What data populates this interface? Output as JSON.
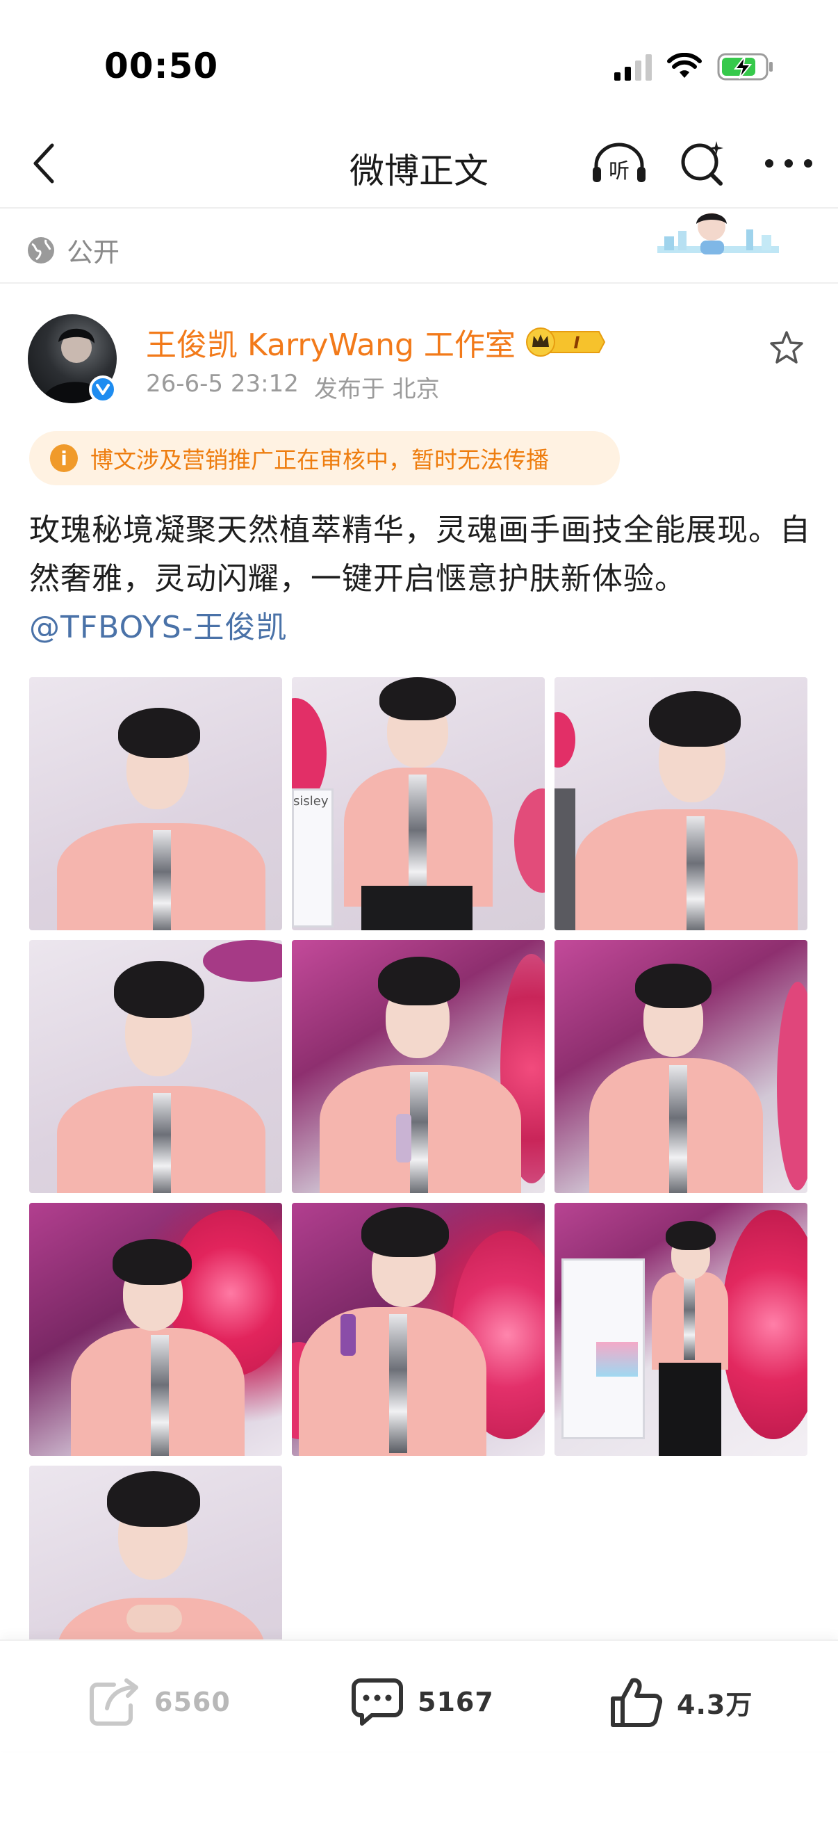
{
  "status_bar": {
    "time": "00:50"
  },
  "nav": {
    "title": "微博正文"
  },
  "visibility": {
    "label": "公开"
  },
  "author": {
    "name": "王俊凯 KarryWang 工作室",
    "date": "26-6-5 23:12",
    "location": "发布于 北京",
    "badge_level": "I"
  },
  "notice": {
    "text": "博文涉及营销推广正在审核中，暂时无法传播"
  },
  "post": {
    "text": "玫瑰秘境凝聚天然植萃精华，灵魂画手画技全能展现。自然奢雅，灵动闪耀，一键开启惬意护肤新体验。",
    "mention": "@TFBOYS-王俊凯"
  },
  "images": {
    "sisley_text": "sisley"
  },
  "actions": {
    "share_count": "6560",
    "comment_count": "5167",
    "like_count": "4.3万"
  }
}
